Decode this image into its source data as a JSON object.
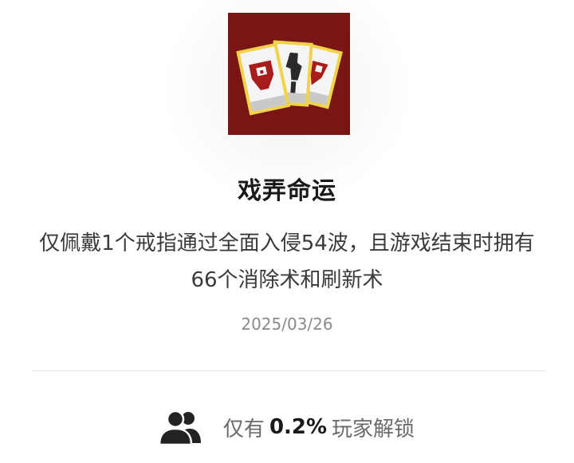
{
  "achievement": {
    "icon": "playing-cards-icon",
    "title": "戏弄命运",
    "description": "仅佩戴1个戒指通过全面入侵54波，且游戏结束时拥有66个消除术和刷新术",
    "date": "2025/03/26"
  },
  "unlock": {
    "icon": "people-icon",
    "prefix": "仅有",
    "percent": "0.2%",
    "suffix": "玩家解锁"
  },
  "colors": {
    "icon_background": "#7a1515",
    "card_border": "#f0d34a",
    "card_face": "#f4f4f4",
    "card_symbol": "#a81c1c"
  }
}
